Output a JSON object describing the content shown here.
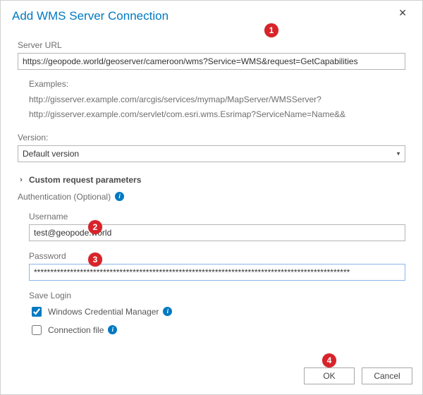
{
  "dialog": {
    "title": "Add WMS Server Connection",
    "close_glyph": "✕"
  },
  "server_url": {
    "label": "Server URL",
    "value": "https://geopode.world/geoserver/cameroon/wms?Service=WMS&request=GetCapabilities"
  },
  "examples": {
    "heading": "Examples:",
    "lines": [
      "http://gisserver.example.com/arcgis/services/mymap/MapServer/WMSServer?",
      "http://gisserver.example.com/servlet/com.esri.wms.Esrimap?ServiceName=Name&&"
    ]
  },
  "version": {
    "label": "Version:",
    "value": "Default version"
  },
  "custom_params": {
    "label": "Custom request parameters"
  },
  "auth": {
    "header": "Authentication (Optional)",
    "username_label": "Username",
    "username_value": "test@geopode.world",
    "password_label": "Password",
    "password_value": "************************************************************************************************"
  },
  "save_login": {
    "header": "Save Login",
    "wcm_label": "Windows Credential Manager",
    "wcm_checked": true,
    "conn_label": "Connection file",
    "conn_checked": false
  },
  "buttons": {
    "ok": "OK",
    "cancel": "Cancel"
  },
  "annotations": {
    "b1": "1",
    "b2": "2",
    "b3": "3",
    "b4": "4"
  }
}
